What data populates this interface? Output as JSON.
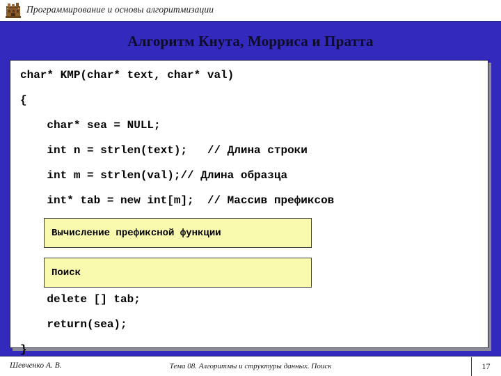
{
  "header": {
    "logo_icon": "castle-building-icon",
    "course_title": "Программирование и основы алгоритмизации"
  },
  "slide": {
    "title": "Алгоритм Кнута, Морриса и Пратта"
  },
  "code": {
    "lines": [
      "char* KMP(char* text, char* val)",
      "{",
      "    char* sea = NULL;",
      "    int n = strlen(text);   // Длина строки",
      "    int m = strlen(val);// Длина образца",
      "    int* tab = new int[m];  // Массив префиксов",
      "    delete [] tab;",
      "    return(sea);",
      "}"
    ]
  },
  "call_boxes": [
    {
      "label": "Вычисление префиксной функции"
    },
    {
      "label": "Поиск"
    }
  ],
  "footer": {
    "author": "Шевченко А. В.",
    "topic": "Тема 08. Алгоритмы и структуры данных. Поиск",
    "page_number": "17"
  },
  "colors": {
    "background_blue": "#3329bd",
    "panel_white": "#ffffff",
    "panel_border": "#22224a",
    "panel_shadow": "#8b8b96",
    "call_box_fill": "#fafaaf",
    "call_box_border": "#3b3b3b",
    "title_text": "#0d0d2b",
    "code_text": "#000000",
    "footer_rule": "#2a2a6e"
  }
}
